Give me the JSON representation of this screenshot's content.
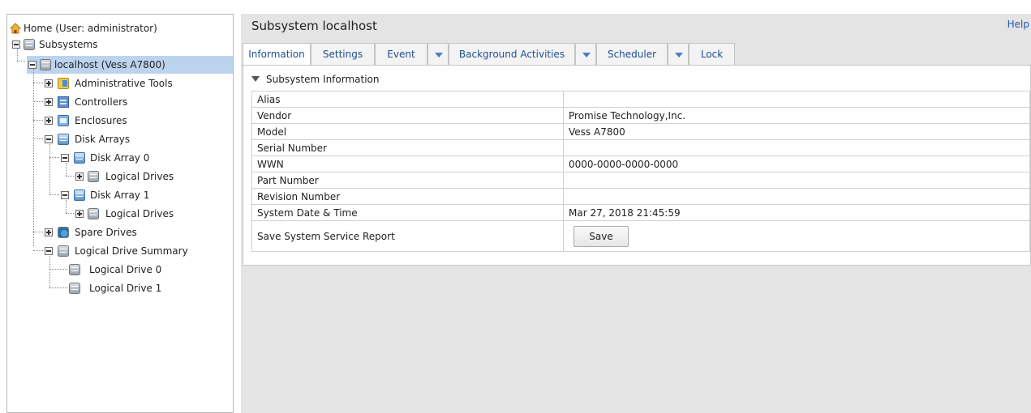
{
  "tree": {
    "home": "Home (User: administrator)",
    "subsystems": "Subsystems",
    "localhost": "localhost (Vess A7800)",
    "administrative_tools": "Administrative Tools",
    "controllers": "Controllers",
    "enclosures": "Enclosures",
    "disk_arrays": "Disk Arrays",
    "disk_array_0": "Disk Array 0",
    "logical_drives_0": "Logical Drives",
    "disk_array_1": "Disk Array 1",
    "logical_drives_1": "Logical Drives",
    "spare_drives": "Spare Drives",
    "logical_drive_summary": "Logical Drive Summary",
    "logical_drive_0": "Logical Drive 0",
    "logical_drive_1": "Logical Drive 1"
  },
  "header": {
    "title": "Subsystem localhost",
    "help": "Help"
  },
  "tabs": {
    "information": "Information",
    "settings": "Settings",
    "event": "Event",
    "background_activities": "Background Activities",
    "scheduler": "Scheduler",
    "lock": "Lock",
    "active": "Information"
  },
  "section": {
    "title": "Subsystem Information"
  },
  "info_rows": [
    {
      "label": "Alias",
      "value": ""
    },
    {
      "label": "Vendor",
      "value": "Promise Technology,Inc."
    },
    {
      "label": "Model",
      "value": "Vess A7800"
    },
    {
      "label": "Serial Number",
      "value": ""
    },
    {
      "label": "WWN",
      "value": "0000-0000-0000-0000"
    },
    {
      "label": "Part Number",
      "value": ""
    },
    {
      "label": "Revision Number",
      "value": ""
    },
    {
      "label": "System Date & Time",
      "value": "Mar 27, 2018 21:45:59"
    }
  ],
  "service_report": {
    "label": "Save System Service Report",
    "button": "Save"
  },
  "colors": {
    "selection": "#bcd3ee",
    "link": "#1e5aa8",
    "pane_background": "#e4e4e4"
  }
}
